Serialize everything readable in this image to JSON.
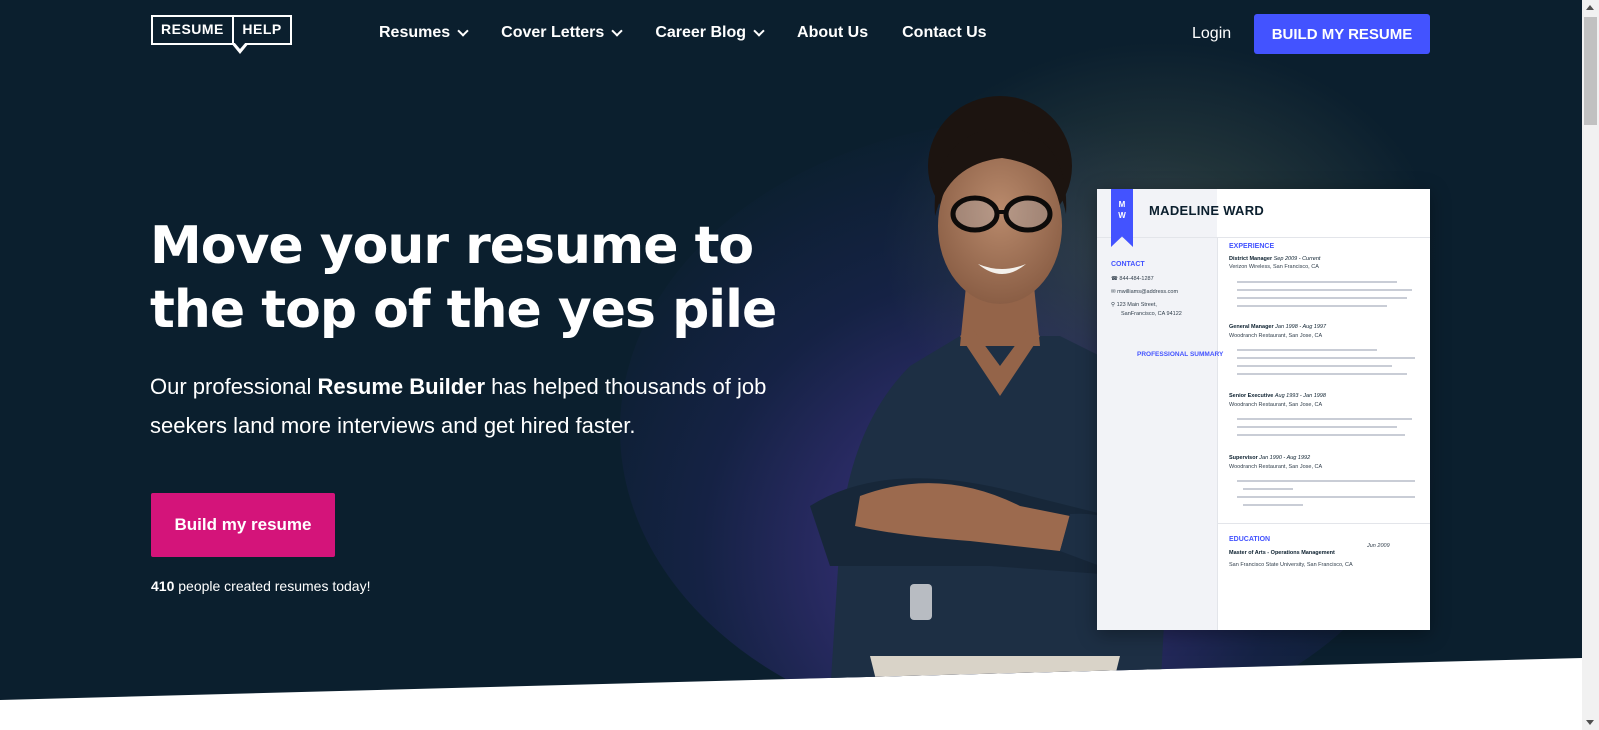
{
  "nav": {
    "logo_left": "RESUME",
    "logo_right": "HELP",
    "items": [
      {
        "label": "Resumes",
        "has_dropdown": true
      },
      {
        "label": "Cover Letters",
        "has_dropdown": true
      },
      {
        "label": "Career Blog",
        "has_dropdown": true
      },
      {
        "label": "About Us",
        "has_dropdown": false
      },
      {
        "label": "Contact Us",
        "has_dropdown": false
      }
    ],
    "login": "Login",
    "cta": "BUILD MY RESUME"
  },
  "hero": {
    "headline_line1": "Move your resume to",
    "headline_line2": "the top of the yes pile",
    "sub_before": "Our professional ",
    "sub_bold": "Resume Builder",
    "sub_after": " has helped thousands of job seekers land more interviews and get hired faster.",
    "cta": "Build my resume",
    "stat_number": "410",
    "stat_text": " people created resumes today!"
  },
  "resume_card": {
    "initials_top": "M",
    "initials_bottom": "W",
    "name": "MADELINE WARD",
    "contact_label": "CONTACT",
    "phone": "844-484-1287",
    "email": "mwilliams@address.com",
    "address_line1": "123 Main Street,",
    "address_line2": "SanFrancisco, CA 94122",
    "summary_label": "PROFESSIONAL SUMMARY",
    "experience_label": "EXPERIENCE",
    "jobs": [
      {
        "title": "District Manager",
        "dates": "Sep 2009 - Current",
        "company": "Verizon Wireless, San Francisco, CA"
      },
      {
        "title": "General Manager",
        "dates": "Jan 1998 - Aug 1997",
        "company": "Woodranch Restaurant, San Jose, CA"
      },
      {
        "title": "Senior Executive",
        "dates": "Aug 1993 - Jan 1998",
        "company": "Woodranch Restaurant, San Jose, CA"
      },
      {
        "title": "Supervisor",
        "dates": "Jan 1990 - Aug 1992",
        "company": "Woodranch Restaurant, San Jose, CA"
      }
    ],
    "education_label": "EDUCATION",
    "degree": "Master of Arts - Operations Management",
    "degree_date": "Jun 2009",
    "school": "San Francisco State University, San Francisco, CA"
  },
  "colors": {
    "hero_bg": "#0b1f2e",
    "accent_blue": "#4353ff",
    "accent_pink": "#d4147a"
  }
}
